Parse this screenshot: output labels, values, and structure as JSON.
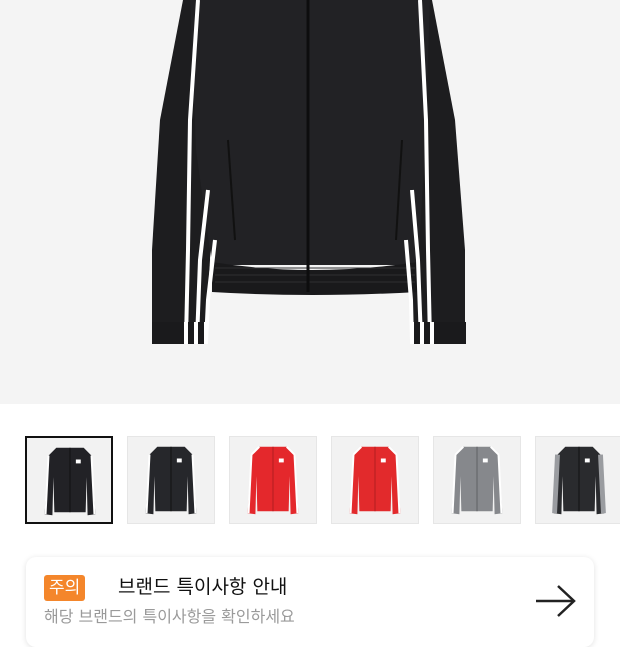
{
  "product": {
    "colors": {
      "jacket_black": "#1f1f21",
      "stripe": "#ffffff",
      "jacket_red": "#e4282c",
      "jacket_grey": "#8a8c90",
      "background": "#f4f4f4"
    },
    "thumbnails": [
      {
        "icon": "black-jacket",
        "body": "#222226",
        "stripe": "#ffffff",
        "selected": true
      },
      {
        "icon": "black-jacket",
        "body": "#26272b",
        "stripe": "#ffffff",
        "selected": false
      },
      {
        "icon": "red-jacket",
        "body": "#e4282c",
        "stripe": "#ffffff",
        "selected": false
      },
      {
        "icon": "red-jacket",
        "body": "#e22a2c",
        "stripe": "#ffffff",
        "selected": false
      },
      {
        "icon": "grey-jacket",
        "body": "#86888c",
        "stripe": "#ffffff",
        "selected": false
      },
      {
        "icon": "black-grey-jacket",
        "body": "#2a2b2e",
        "stripe": "#9a9ca0",
        "selected": false
      }
    ]
  },
  "notice": {
    "badge": "주의",
    "title": "브랜드 특이사항 안내",
    "subtitle": "해당 브랜드의 특이사항을 확인하세요",
    "accent": "#f4862b",
    "arrow_icon": "arrow-right-icon"
  }
}
